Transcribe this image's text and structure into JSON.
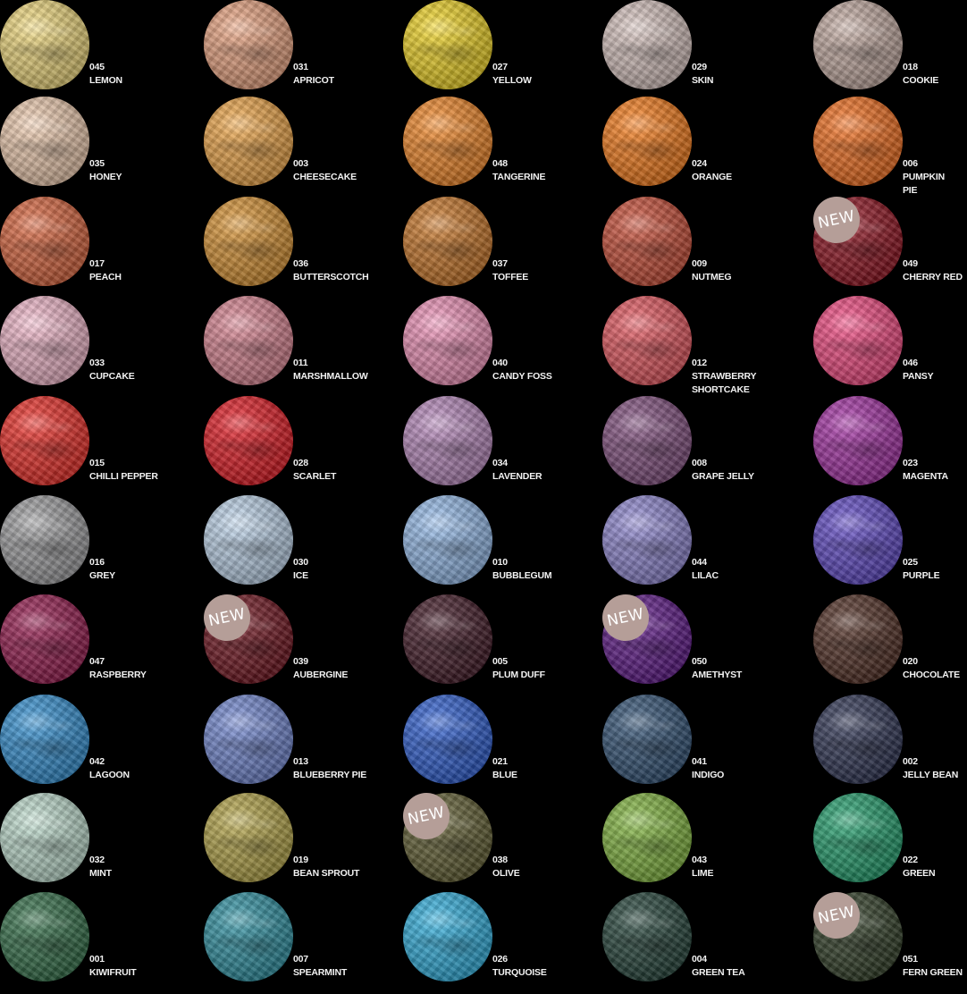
{
  "new_label": "NEW",
  "rows": [
    [
      {
        "code": "045",
        "name": "LEMON",
        "color": "#f1d97a",
        "new": false
      },
      {
        "code": "031",
        "name": "APRICOT",
        "color": "#eaa27e",
        "new": false
      },
      {
        "code": "027",
        "name": "YELLOW",
        "color": "#f2d520",
        "new": false
      },
      {
        "code": "029",
        "name": "SKIN",
        "color": "#d6c2bd",
        "new": false
      },
      {
        "code": "018",
        "name": "COOKIE",
        "color": "#c3aaa0",
        "new": false
      }
    ],
    [
      {
        "code": "035",
        "name": "HONEY",
        "color": "#efcbae",
        "new": false
      },
      {
        "code": "003",
        "name": "CHEESECAKE",
        "color": "#efa545",
        "new": false
      },
      {
        "code": "048",
        "name": "TANGERINE",
        "color": "#f38624",
        "new": false
      },
      {
        "code": "024",
        "name": "ORANGE",
        "color": "#f77a16",
        "new": false
      },
      {
        "code": "006",
        "name": "PUMPKIN\nPIE",
        "color": "#f36c1a",
        "new": false
      }
    ],
    [
      {
        "code": "017",
        "name": "PEACH",
        "color": "#d9623a",
        "new": false
      },
      {
        "code": "036",
        "name": "BUTTERSCOTCH",
        "color": "#d8912f",
        "new": false
      },
      {
        "code": "037",
        "name": "TOFFEE",
        "color": "#c97424",
        "new": false
      },
      {
        "code": "009",
        "name": "NUTMEG",
        "color": "#c84a33",
        "new": false
      },
      {
        "code": "049",
        "name": "CHERRY RED",
        "color": "#8e0d1b",
        "new": true
      }
    ],
    [
      {
        "code": "033",
        "name": "CUPCAKE",
        "color": "#f1b6c9",
        "new": false
      },
      {
        "code": "011",
        "name": "MARSHMALLOW",
        "color": "#d8818f",
        "new": false
      },
      {
        "code": "040",
        "name": "CANDY FOSS",
        "color": "#ef90b7",
        "new": false
      },
      {
        "code": "012",
        "name": "STRAWBERRY\nSHORTCAKE",
        "color": "#e4545c",
        "new": false
      },
      {
        "code": "046",
        "name": "PANSY",
        "color": "#f2467f",
        "new": false
      }
    ],
    [
      {
        "code": "015",
        "name": "CHILLI PEPPER",
        "color": "#ec2a23",
        "new": false
      },
      {
        "code": "028",
        "name": "SCARLET",
        "color": "#e2161f",
        "new": false
      },
      {
        "code": "034",
        "name": "LAVENDER",
        "color": "#b586ba",
        "new": false
      },
      {
        "code": "008",
        "name": "GRAPE JELLY",
        "color": "#7f4c7c",
        "new": false
      },
      {
        "code": "023",
        "name": "MAGENTA",
        "color": "#a32da3",
        "new": false
      }
    ],
    [
      {
        "code": "016",
        "name": "GREY",
        "color": "#9d9d9f",
        "new": false
      },
      {
        "code": "030",
        "name": "ICE",
        "color": "#bcd3ea",
        "new": false
      },
      {
        "code": "010",
        "name": "BUBBLEGUM",
        "color": "#93baea",
        "new": false
      },
      {
        "code": "044",
        "name": "LILAC",
        "color": "#8c84cf",
        "new": false
      },
      {
        "code": "025",
        "name": "PURPLE",
        "color": "#5d46c5",
        "new": false
      }
    ],
    [
      {
        "code": "047",
        "name": "RASPBERRY",
        "color": "#93164a",
        "new": false
      },
      {
        "code": "039",
        "name": "AUBERGINE",
        "color": "#6d0f1a",
        "new": true
      },
      {
        "code": "005",
        "name": "PLUM DUFF",
        "color": "#3d1421",
        "new": false
      },
      {
        "code": "050",
        "name": "AMETHYST",
        "color": "#5b1486",
        "new": true
      },
      {
        "code": "020",
        "name": "CHOCOLATE",
        "color": "#4d2a1f",
        "new": false
      }
    ],
    [
      {
        "code": "042",
        "name": "LAGOON",
        "color": "#2f8ed1",
        "new": false
      },
      {
        "code": "013",
        "name": "BLUEBERRY PIE",
        "color": "#6f85d0",
        "new": false
      },
      {
        "code": "021",
        "name": "BLUE",
        "color": "#2a5bd0",
        "new": false
      },
      {
        "code": "041",
        "name": "INDIGO",
        "color": "#2d4e72",
        "new": false
      },
      {
        "code": "002",
        "name": "JELLY BEAN",
        "color": "#2a3050",
        "new": false
      }
    ],
    [
      {
        "code": "032",
        "name": "MINT",
        "color": "#bddccd",
        "new": false
      },
      {
        "code": "019",
        "name": "BEAN SPROUT",
        "color": "#b3a344",
        "new": false
      },
      {
        "code": "038",
        "name": "OLIVE",
        "color": "#5e5b2e",
        "new": true
      },
      {
        "code": "043",
        "name": "LIME",
        "color": "#7fb43b",
        "new": false
      },
      {
        "code": "022",
        "name": "GREEN",
        "color": "#1e9d6a",
        "new": false
      }
    ],
    [
      {
        "code": "001",
        "name": "KIWIFRUIT",
        "color": "#2e6b44",
        "new": false
      },
      {
        "code": "007",
        "name": "SPEARMINT",
        "color": "#2a8fa0",
        "new": false
      },
      {
        "code": "026",
        "name": "TURQUOISE",
        "color": "#2caedd",
        "new": false
      },
      {
        "code": "004",
        "name": "GREEN TEA",
        "color": "#1f3f35",
        "new": false
      },
      {
        "code": "051",
        "name": "FERN GREEN",
        "color": "#2c3a22",
        "new": true
      }
    ]
  ]
}
